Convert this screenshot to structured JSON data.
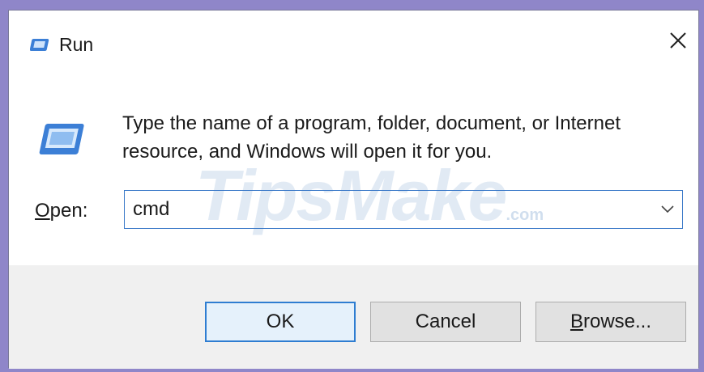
{
  "window": {
    "title": "Run",
    "title_icon": "run-icon",
    "close_icon": "close-icon"
  },
  "content": {
    "icon": "run-icon",
    "description": "Type the name of a program, folder, document, or Internet resource, and Windows will open it for you.",
    "open_label_accel": "O",
    "open_label_rest": "pen:",
    "input_value": "cmd",
    "dropdown_icon": "chevron-down-icon"
  },
  "watermark": {
    "text": "TipsMake",
    "suffix": ".com"
  },
  "buttons": {
    "ok_label": "OK",
    "cancel_label": "Cancel",
    "browse_accel": "B",
    "browse_rest": "rowse..."
  },
  "colors": {
    "accent": "#2e7dd1",
    "background_frame": "#8f86c9",
    "footer": "#f0f0f0"
  }
}
